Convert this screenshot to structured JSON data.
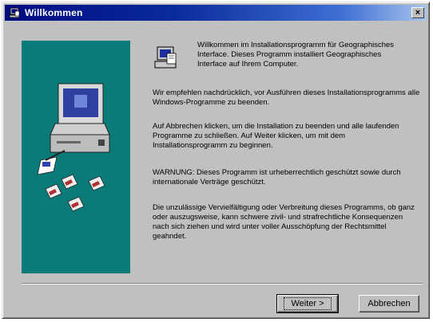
{
  "window": {
    "title": "Willkommen",
    "close_glyph": "×"
  },
  "intro_text": "Willkommen im Installationsprogramm für Geographisches Interface. Dieses Programm installiert Geographisches Interface auf Ihrem Computer.",
  "paragraphs": [
    "Wir empfehlen nachdrücklich, vor Ausführen dieses Installationsprogramms alle Windows-Programme zu beenden.",
    "Auf Abbrechen klicken, um die Installation zu beenden und alle laufenden Programme zu schließen. Auf Weiter klicken, um mit dem Installationsprogramm zu beginnen.",
    "WARNUNG: Dieses Programm ist urheberrechtlich geschützt sowie durch internationale Verträge geschützt.",
    "Die unzulässige Vervielfältigung oder Verbreitung dieses Programms, ob ganz oder auszugsweise, kann schwere zivil- und strafrechtliche Konsequenzen nach sich ziehen und wird unter voller Ausschöpfung der Rechtsmittel geahndet."
  ],
  "buttons": {
    "next_label": "Weiter >",
    "cancel_label": "Abbrechen"
  },
  "colors": {
    "titlebar": "#000c84",
    "banner": "#0b7b7a",
    "dialog": "#c0c0c0"
  },
  "icons": {
    "title": "setup-icon",
    "content": "setup-computer-icon",
    "banner": "computer-illustration"
  }
}
